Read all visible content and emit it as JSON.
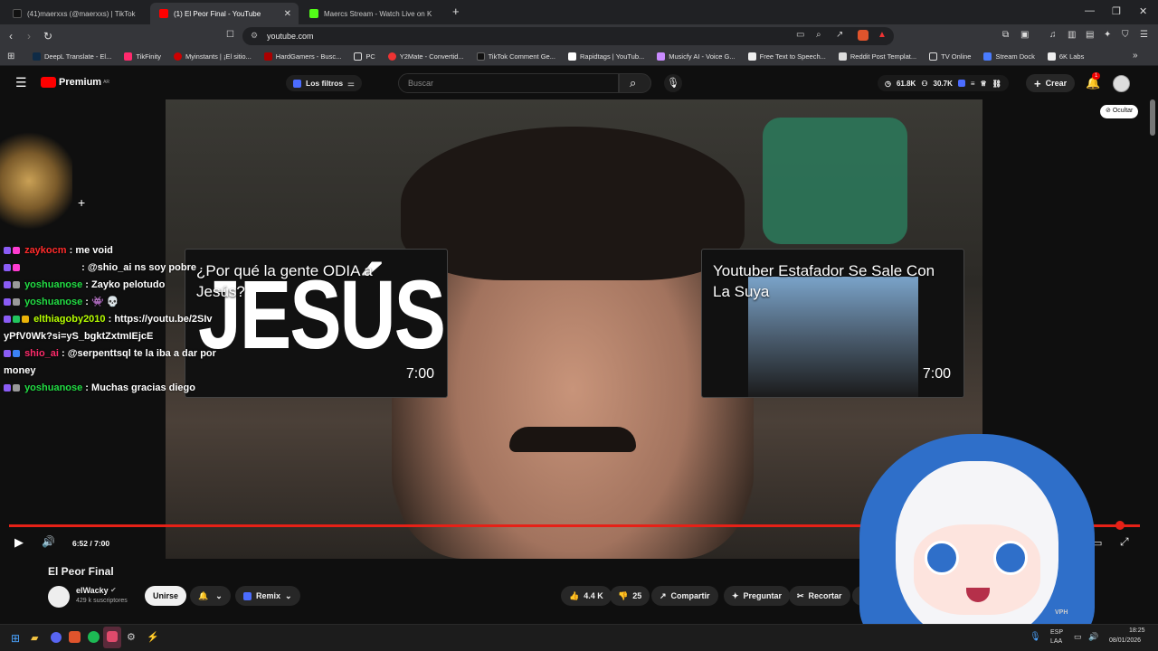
{
  "tabs": [
    {
      "label": "(41)maerxxs (@maerxxs) | TikTok"
    },
    {
      "label": "(1) El Peor Final - YouTube"
    },
    {
      "label": "Maercs Stream - Watch Live on K"
    }
  ],
  "address": {
    "url": "youtube.com"
  },
  "bookmarks": [
    "DeepL Translate - El...",
    "TikFinity",
    "Myinstants | ¡El sitio...",
    "HardGamers - Busc...",
    "PC",
    "Y2Mate - Convertid...",
    "TikTok Comment Ge...",
    "Rapidtags | YouTub...",
    "Musicfy AI - Voice G...",
    "Free Text to Speech...",
    "Reddit Post Templat...",
    "TV Online",
    "Stream Dock",
    "6K Labs"
  ],
  "yt": {
    "logo": "Premium",
    "region": "AR",
    "filters": "Los filtros",
    "search_placeholder": "Buscar",
    "stat1": "61.8K",
    "stat2": "30.7K",
    "create": "Crear",
    "notif_count": "1",
    "hide": "Ocultar"
  },
  "endcards": [
    {
      "title": "¿Por qué la gente ODIA a Jesús?",
      "big": "JESÚS",
      "duration": "7:00"
    },
    {
      "title": "Youtuber Estafador Se Sale Con La Suya",
      "duration": "7:00"
    }
  ],
  "chat": [
    {
      "user": "zaykocm",
      "color": "#ff2b2b",
      "text": "me void"
    },
    {
      "user": "",
      "color": "#3344aa",
      "text": "@shio_ai ns soy pobre"
    },
    {
      "user": "yoshuanose",
      "color": "#22dd44",
      "text": "Zayko pelotudo"
    },
    {
      "user": "yoshuanose",
      "color": "#22dd44",
      "text": ""
    },
    {
      "user": "elthiagoby2010",
      "color": "#b6ff00",
      "text": "https://youtu.be/2SIvyPfV0Wk?si=yS_bgktZxtmIEjcE"
    },
    {
      "user": "shio_ai",
      "color": "#ff2b6b",
      "text": "@serpenttsql te la iba a dar por money"
    },
    {
      "user": "yoshuanose",
      "color": "#22dd44",
      "text": "Muchas gracias diego"
    }
  ],
  "player": {
    "time": "6:52 / 7:00",
    "progress": 0.98
  },
  "video": {
    "title": "El Peor Final",
    "channel": "elWacky",
    "subs": "429 k suscriptores",
    "join": "Unirse",
    "remix": "Remix",
    "likes": "4.4 K",
    "dislikes": "25",
    "share": "Compartir",
    "ask": "Preguntar",
    "clip": "Recortar"
  },
  "taskbar": {
    "lang1": "ESP",
    "lang2": "LAA",
    "time": "18:25",
    "date": "08/01/2026",
    "vph": "VPH"
  }
}
